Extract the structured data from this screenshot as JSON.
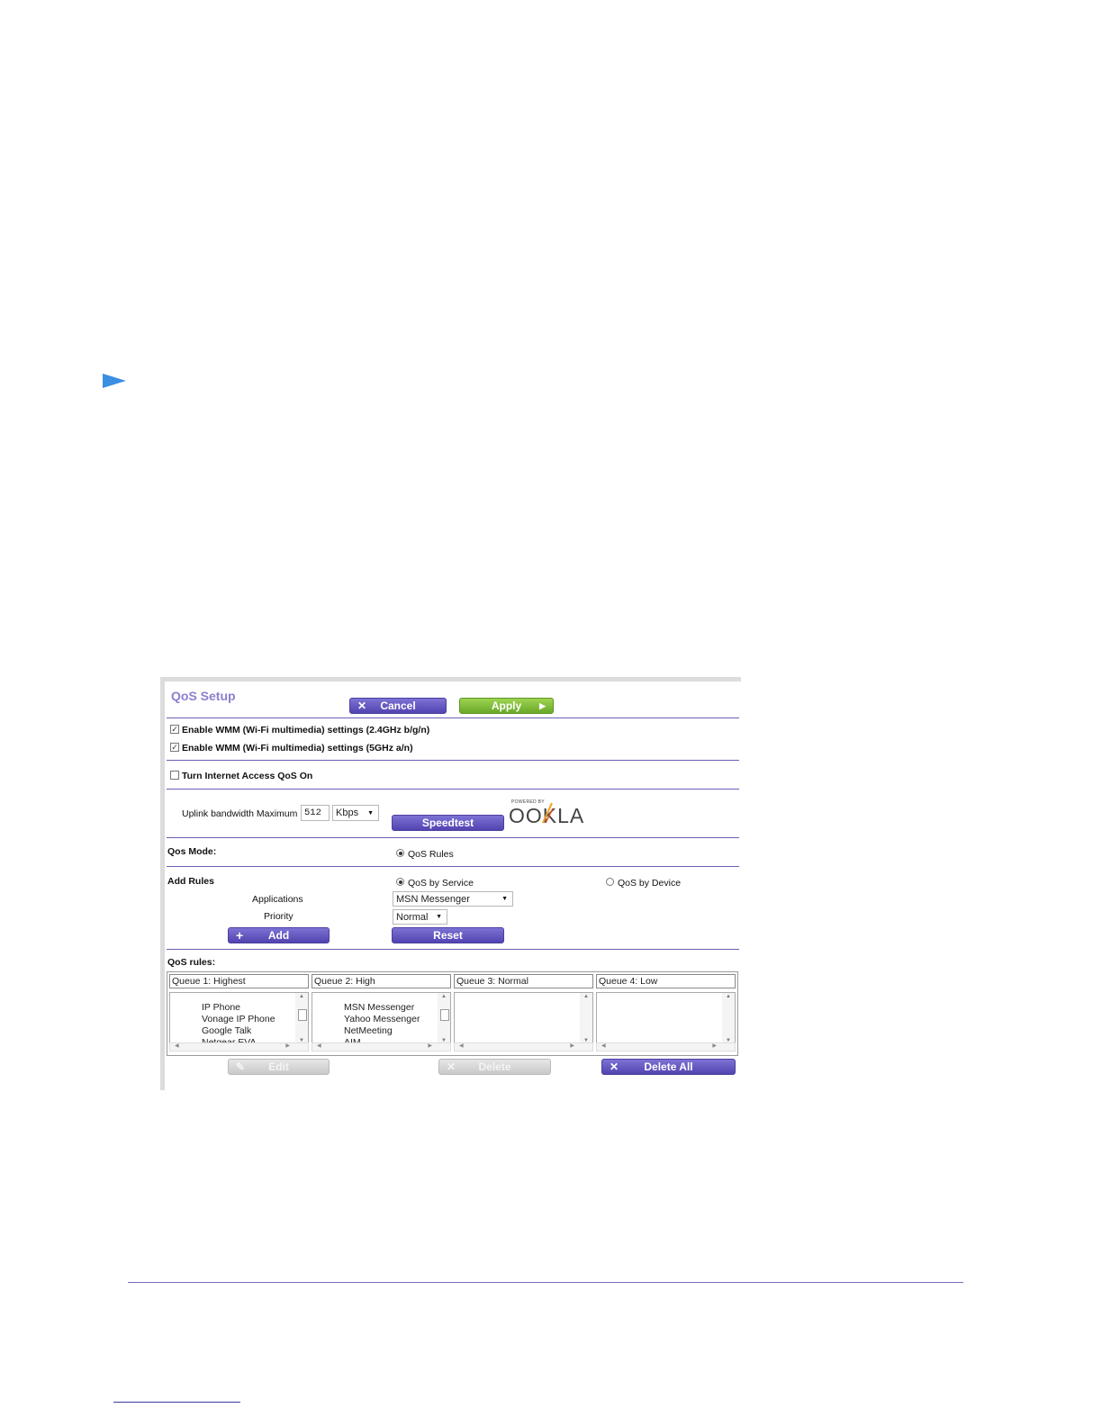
{
  "colors": {
    "accent_purple": "#5b4eb8",
    "apply_green": "#7cc033",
    "arrow_blue": "#3a8fe0",
    "title_lavender": "#8b7fd0"
  },
  "qos_setup": {
    "title": "QoS Setup",
    "cancel_label": "Cancel",
    "apply_label": "Apply",
    "wmm_24": {
      "label": "Enable WMM (Wi-Fi multimedia) settings (2.4GHz b/g/n)",
      "checked": true
    },
    "wmm_5": {
      "label": "Enable WMM (Wi-Fi multimedia) settings (5GHz a/n)",
      "checked": true
    },
    "internet_qos": {
      "label": "Turn Internet Access QoS On",
      "checked": false
    },
    "uplink": {
      "label": "Uplink bandwidth Maximum",
      "value": "512",
      "unit": "Kbps"
    },
    "speedtest_label": "Speedtest",
    "ookla": {
      "powered_by": "POWERED BY",
      "logo": "OOKLA"
    },
    "qos_mode": {
      "label": "Qos Mode:",
      "option": "QoS Rules"
    },
    "add_rules": {
      "label": "Add Rules",
      "by_service": "QoS by Service",
      "by_device": "QoS by Device",
      "applications_label": "Applications",
      "applications_value": "MSN Messenger",
      "priority_label": "Priority",
      "priority_value": "Normal",
      "add_label": "Add",
      "reset_label": "Reset"
    },
    "qos_rules": {
      "label": "QoS rules:",
      "queues": [
        {
          "header": "Queue 1: Highest",
          "items": [
            "IP Phone",
            "Vonage IP Phone",
            "Google Talk",
            "Netgear EVA"
          ]
        },
        {
          "header": "Queue 2: High",
          "items": [
            "MSN Messenger",
            "Yahoo Messenger",
            "NetMeeting",
            "AIM"
          ]
        },
        {
          "header": "Queue 3: Normal",
          "items": []
        },
        {
          "header": "Queue 4: Low",
          "items": []
        }
      ]
    },
    "edit_label": "Edit",
    "delete_label": "Delete",
    "delete_all_label": "Delete All"
  }
}
